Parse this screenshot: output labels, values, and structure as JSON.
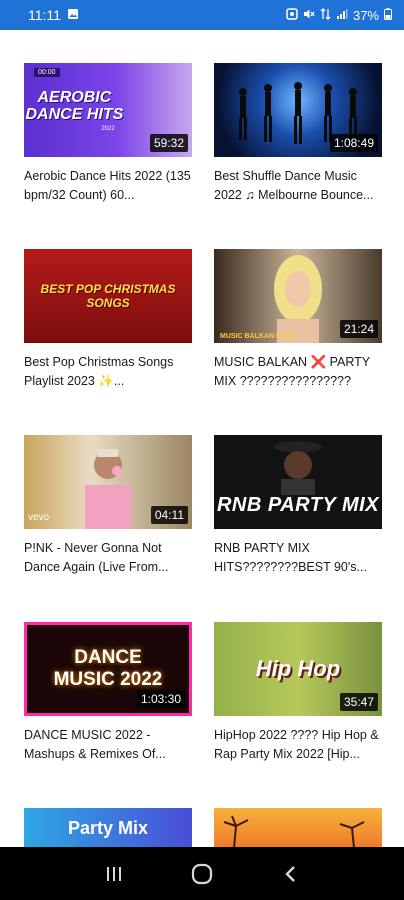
{
  "status_bar": {
    "time": "11:11",
    "battery": "37%"
  },
  "videos": [
    {
      "title": "Aerobic Dance Hits 2022 (135 bpm/32 Count) 60...",
      "duration": "59:32",
      "thumb_text": "AEROBIC DANCE HITS",
      "thumb_badge": "00:00",
      "thumb_sub": "2022"
    },
    {
      "title": "Best Shuffle Dance Music 2022 ♫ Melbourne Bounce...",
      "duration": "1:08:49",
      "thumb_text": ""
    },
    {
      "title": "Best Pop Christmas Songs Playlist 2023 ✨...",
      "duration": "",
      "thumb_text": "BEST POP CHRISTMAS SONGS"
    },
    {
      "title": "MUSIC BALKAN ❌ PARTY MIX ????????????????",
      "duration": "21:24",
      "thumb_text": "MUSIC BALKAN PARTY"
    },
    {
      "title": "P!NK - Never Gonna Not Dance Again (Live From...",
      "duration": "04:11",
      "thumb_text": "vevo"
    },
    {
      "title": "RNB PARTY MIX HITS????????BEST 90's...",
      "duration": "",
      "thumb_text": "RNB PARTY MIX"
    },
    {
      "title": "DANCE MUSIC 2022 - Mashups & Remixes Of...",
      "duration": "1:03:30",
      "thumb_text": "DANCE MUSIC 2022"
    },
    {
      "title": "HipHop 2022 ???? Hip Hop & Rap Party Mix 2022 [Hip...",
      "duration": "35:47",
      "thumb_text": "Hip Hop"
    },
    {
      "title": "",
      "duration": "",
      "thumb_text": "Party Mix"
    },
    {
      "title": "",
      "duration": "",
      "thumb_text": ""
    }
  ],
  "icons": {
    "status_left": "image-icon",
    "status_right": [
      "alarm-icon",
      "mute-icon",
      "data-icon",
      "signal-icon",
      "battery-icon"
    ],
    "nav": [
      "recents-icon",
      "home-icon",
      "back-icon"
    ]
  }
}
